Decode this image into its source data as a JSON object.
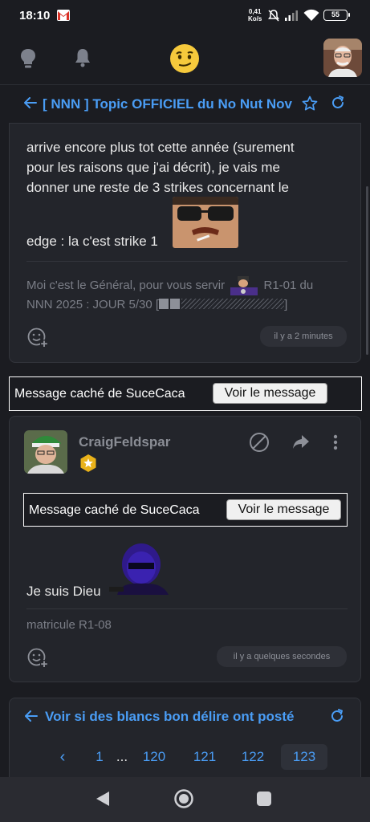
{
  "status_bar": {
    "time": "18:10",
    "net_rate_value": "0,41",
    "net_rate_unit": "Ko/s",
    "battery": "55",
    "icons": [
      "gmail-icon",
      "mute-icon",
      "signal-icon",
      "wifi-icon",
      "battery-icon"
    ]
  },
  "header": {
    "icons": [
      "lightbulb-icon",
      "bell-icon",
      "smiley-logo",
      "user-avatar"
    ]
  },
  "topic": {
    "title": "[ NNN ] Topic OFFICIEL du No Nut Nov"
  },
  "post1": {
    "text_lines": [
      "arrive encore plus tot cette année (surement",
      "pour les raisons que j'ai décrit), je vais me",
      "donner une reste de 3 strikes concernant le"
    ],
    "text_after_sticker": "edge : la c'est strike 1",
    "signature_part1": "Moi c'est le Général, pour vous servir",
    "signature_part2": "R1-01 du",
    "signature_line2": "NNN 2025 : JOUR 5/30 [",
    "signature_end": "]",
    "time": "il y a 2 minutes"
  },
  "hidden_message_1": {
    "label": "Message caché de SuceCaca",
    "button": "Voir le message"
  },
  "post2": {
    "username": "CraigFeldspar",
    "hidden_label": "Message caché de SuceCaca",
    "hidden_button": "Voir le message",
    "text": "Je suis Dieu",
    "signature": "matricule R1-08",
    "time": "il y a quelques secondes"
  },
  "pagination": {
    "title": "Voir si des blancs bon délire ont posté",
    "prev": "‹",
    "pages": [
      "1",
      "...",
      "120",
      "121",
      "122",
      "123"
    ],
    "current": "123"
  },
  "colors": {
    "accent": "#4a9df5",
    "background": "#1b1c21",
    "card": "#23252b"
  }
}
